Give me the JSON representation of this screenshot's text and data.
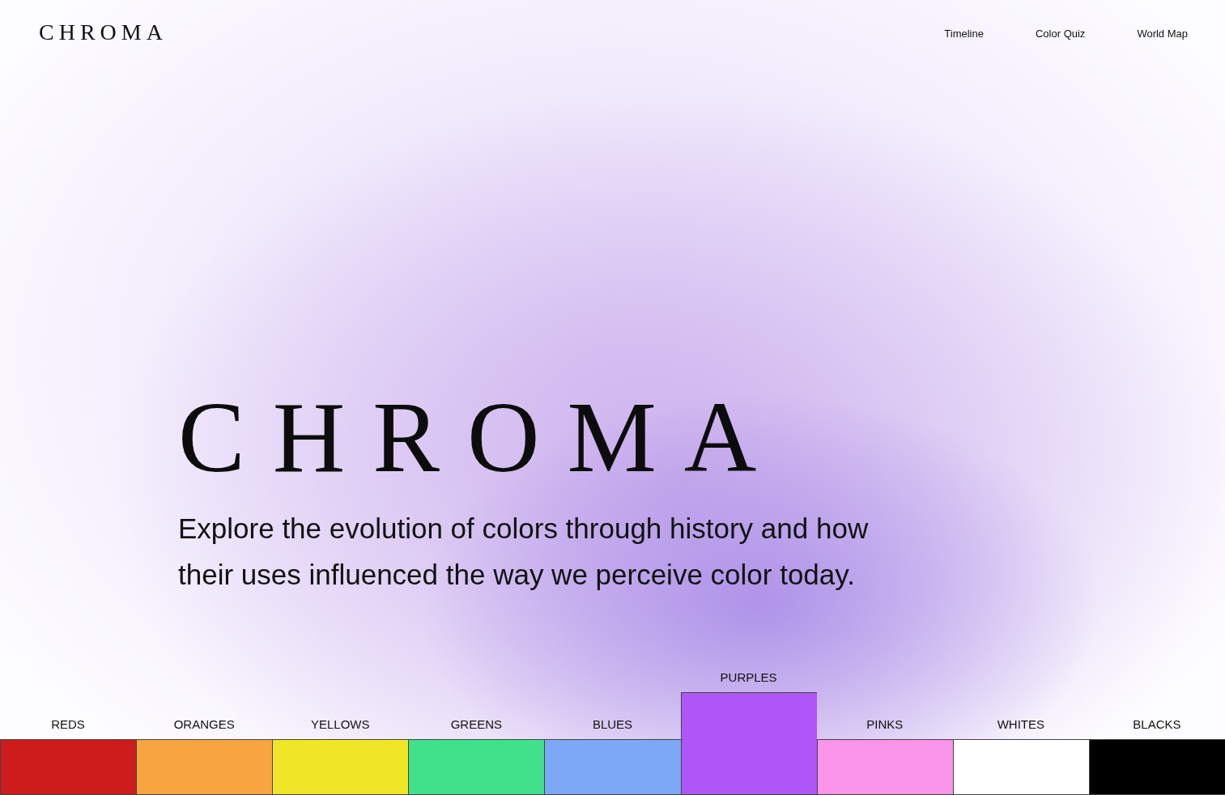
{
  "header": {
    "logo": "CHROMA",
    "nav": [
      {
        "label": "Timeline"
      },
      {
        "label": "Color Quiz"
      },
      {
        "label": "World Map"
      }
    ]
  },
  "hero": {
    "title": "CHROMA",
    "subtitle": "Explore the evolution of colors through history and how their uses influenced the way we perceive color today."
  },
  "swatches": [
    {
      "label": "REDS",
      "color": "#cc1c1c",
      "selected": false
    },
    {
      "label": "ORANGES",
      "color": "#f7a541",
      "selected": false
    },
    {
      "label": "YELLOWS",
      "color": "#f0e626",
      "selected": false
    },
    {
      "label": "GREENS",
      "color": "#41e08a",
      "selected": false
    },
    {
      "label": "BLUES",
      "color": "#7da8f5",
      "selected": false
    },
    {
      "label": "PURPLES",
      "color": "#b055f8",
      "selected": true
    },
    {
      "label": "PINKS",
      "color": "#f994e8",
      "selected": false
    },
    {
      "label": "WHITES",
      "color": "#ffffff",
      "selected": false
    },
    {
      "label": "BLACKS",
      "color": "#000000",
      "selected": false
    }
  ]
}
